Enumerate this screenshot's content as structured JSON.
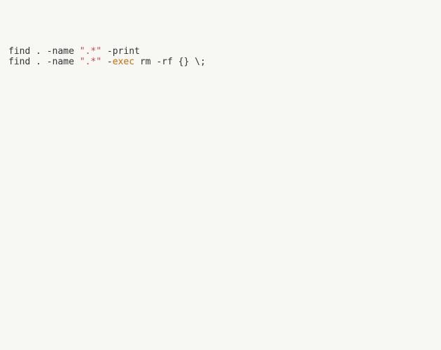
{
  "code": {
    "lines": [
      {
        "tokens": [
          {
            "text": "find . -name ",
            "class": "tok-default"
          },
          {
            "text": "\".*\"",
            "class": "tok-string"
          },
          {
            "text": " -print",
            "class": "tok-default"
          }
        ]
      },
      {
        "tokens": [
          {
            "text": "find . -name ",
            "class": "tok-default"
          },
          {
            "text": "\".*\"",
            "class": "tok-string"
          },
          {
            "text": " -",
            "class": "tok-default"
          },
          {
            "text": "exec",
            "class": "tok-keyword"
          },
          {
            "text": " rm -rf {} \\;",
            "class": "tok-default"
          }
        ]
      }
    ]
  }
}
